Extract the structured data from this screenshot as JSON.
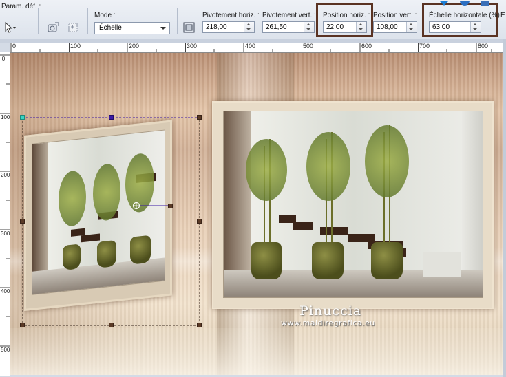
{
  "toolbar": {
    "presets_label": "Param. déf. :",
    "mode_label": "Mode :",
    "mode_value": "Échelle",
    "fields": [
      {
        "label": "Pivotement horiz. :",
        "value": "218,00"
      },
      {
        "label": "Pivotement vert. :",
        "value": "261,50"
      },
      {
        "label": "Position horiz. :",
        "value": "22,00"
      },
      {
        "label": "Position vert. :",
        "value": "108,00"
      },
      {
        "label": "Échelle horizontale (%) :",
        "value": "63,00"
      }
    ],
    "truncated_label": "E",
    "icons": [
      "pick-tool-icon",
      "reset-icon",
      "copy-icon",
      "frame-icon",
      "apply-icon",
      "cancel-icon",
      "help-icon"
    ]
  },
  "ruler": {
    "h_labels": [
      "0",
      "100",
      "200",
      "300",
      "400",
      "500",
      "600",
      "700",
      "800"
    ],
    "v_labels": [
      "0",
      "100",
      "200",
      "300",
      "400",
      "500"
    ]
  },
  "watermark": {
    "name": "Pinuccia",
    "url": "www.maidiregrafica.eu"
  },
  "colors": {
    "highlight": "#5a3323",
    "selection_accent": "#3b1aa6",
    "handle_corner": "#39d5c2"
  }
}
